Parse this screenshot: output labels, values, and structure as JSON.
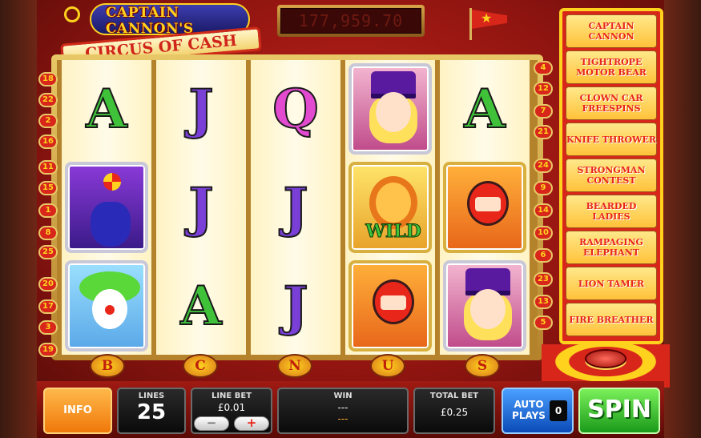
{
  "game": {
    "logo_line1": "CAPTAIN CANNON'S",
    "logo_line2": "CIRCUS OF CASH",
    "jackpot": "177,959.70"
  },
  "reels": [
    [
      {
        "type": "letter",
        "value": "A",
        "color": "#3fc23a"
      },
      {
        "type": "pic",
        "icon": "seal-icon"
      },
      {
        "type": "pic",
        "icon": "clown-icon"
      }
    ],
    [
      {
        "type": "letter",
        "value": "J",
        "color": "#7a3fd6"
      },
      {
        "type": "letter",
        "value": "J",
        "color": "#7a3fd6"
      },
      {
        "type": "letter",
        "value": "A",
        "color": "#3fc23a"
      }
    ],
    [
      {
        "type": "letter",
        "value": "Q",
        "color": "#e24ad0"
      },
      {
        "type": "letter",
        "value": "J",
        "color": "#7a3fd6"
      },
      {
        "type": "letter",
        "value": "J",
        "color": "#7a3fd6"
      }
    ],
    [
      {
        "type": "pic",
        "icon": "ringmaster-lady-icon"
      },
      {
        "type": "pic",
        "icon": "lion-wild-icon",
        "label": "WILD"
      },
      {
        "type": "pic",
        "icon": "motorbike-rider-icon"
      }
    ],
    [
      {
        "type": "letter",
        "value": "A",
        "color": "#3fc23a"
      },
      {
        "type": "pic",
        "icon": "motorbike-rider-icon"
      },
      {
        "type": "pic",
        "icon": "ringmaster-lady-icon"
      }
    ]
  ],
  "wild_label": "WILD",
  "paylines_left": [
    "18",
    "22",
    "2",
    "16",
    "11",
    "15",
    "1",
    "8",
    "25",
    "20",
    "17",
    "3",
    "19"
  ],
  "paylines_right": [
    "4",
    "12",
    "7",
    "21",
    "24",
    "9",
    "14",
    "10",
    "6",
    "23",
    "13",
    "5"
  ],
  "reel_letters": [
    "B",
    "C",
    "N",
    "U",
    "S"
  ],
  "features": [
    "CAPTAIN CANNON",
    "TIGHTROPE MOTOR BEAR",
    "CLOWN CAR FREESPINS",
    "KNIFE THROWER",
    "STRONGMAN CONTEST",
    "BEARDED LADIES",
    "RAMPAGING ELEPHANT",
    "LION TAMER",
    "FIRE BREATHER"
  ],
  "controls": {
    "info": "INFO",
    "lines_label": "LINES",
    "lines_value": "25",
    "line_bet_label": "LINE BET",
    "line_bet_value": "£0.01",
    "minus": "−",
    "plus": "+",
    "win_label": "WIN",
    "win_value_1": "---",
    "win_value_2": "---",
    "total_bet_label": "TOTAL BET",
    "total_bet_value": "£0.25",
    "auto_label": "AUTO PLAYS",
    "auto_value": "0",
    "spin": "SPIN"
  },
  "colors": {
    "accent_red": "#d8261a",
    "gold": "#ffd21e",
    "spin_green": "#1a9a1a",
    "info_orange": "#f0780a",
    "auto_blue": "#0a4ab8"
  }
}
